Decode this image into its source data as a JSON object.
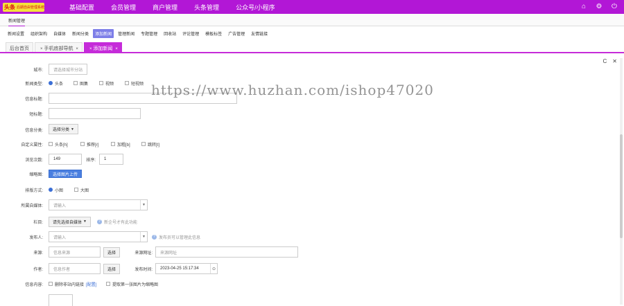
{
  "topbar": {
    "logo_main": "头条",
    "logo_sub": "后期自由管理系统",
    "nav": [
      "基础配置",
      "会员管理",
      "商户管理",
      "头条管理",
      "公众号/小程序"
    ],
    "icons": [
      "home-icon",
      "gear-icon",
      "power-icon"
    ]
  },
  "subbar1": {
    "tab": "新闻管理"
  },
  "subnav": {
    "items": [
      "新闻设置",
      "组织架构",
      "自媒体",
      "新闻分类",
      "添加新闻",
      "管理新闻",
      "专题管理",
      "回收站",
      "评论管理",
      "模板标签",
      "广告管理",
      "友情链接"
    ],
    "active_index": 4
  },
  "tabs": [
    {
      "label": "后台首页",
      "closable": false
    },
    {
      "label": "手机底部导航",
      "closable": true
    },
    {
      "label": "添加新闻",
      "closable": true,
      "active": true
    }
  ],
  "window_controls": {
    "refresh": "C",
    "close": "✕"
  },
  "form": {
    "city": {
      "label": "城市:",
      "placeholder": "请选择城市分站"
    },
    "news_type": {
      "label": "新闻类型:",
      "options": [
        "头条",
        "图集",
        "视频",
        "短视频"
      ],
      "selected": "头条"
    },
    "info_title": {
      "label": "信息标题:"
    },
    "short_title": {
      "label": "短标题:"
    },
    "category": {
      "label": "信息分类:",
      "button": "选择分类"
    },
    "custom_attr": {
      "label": "自定义属性:",
      "options": [
        "头条[h]",
        "推荐[r]",
        "加粗[b]",
        "跳转[t]"
      ]
    },
    "views": {
      "label": "浏览次数:",
      "value": "149"
    },
    "order": {
      "label": "排序:",
      "value": "1"
    },
    "thumbnail": {
      "label": "缩略图:",
      "button": "选择图片上传"
    },
    "layout": {
      "label": "排版方式:",
      "options": [
        "小图",
        "大图"
      ],
      "selected": "小图"
    },
    "media": {
      "label": "所属自媒体:",
      "placeholder": "请输入"
    },
    "column": {
      "label": "栏目:",
      "button": "请先选择自媒体",
      "hint": "新企号才有此功能"
    },
    "publisher": {
      "label": "发布人:",
      "placeholder": "请输入",
      "hint": "发布员可以管理此信息"
    },
    "source": {
      "label": "来源:",
      "placeholder": "信息来源",
      "button": "选择"
    },
    "source_url": {
      "label": "来源网址:",
      "placeholder": "来源网址"
    },
    "author": {
      "label": "作者:",
      "placeholder": "信息作者",
      "button": "选择"
    },
    "publish_time": {
      "label": "发布时间:",
      "value": "2023-04-25 15:17:34"
    },
    "content": {
      "label": "信息内容:",
      "opt1": "删除非站内链接",
      "opt1_link": "[配置]",
      "opt2": "提取第一张图片为缩略图"
    }
  },
  "watermark": "https://www.huzhan.com/ishop47020",
  "colors": {
    "brand": "#b217d6",
    "tab_active": "#c52bd9",
    "accent_blue": "#3b6fd6"
  }
}
